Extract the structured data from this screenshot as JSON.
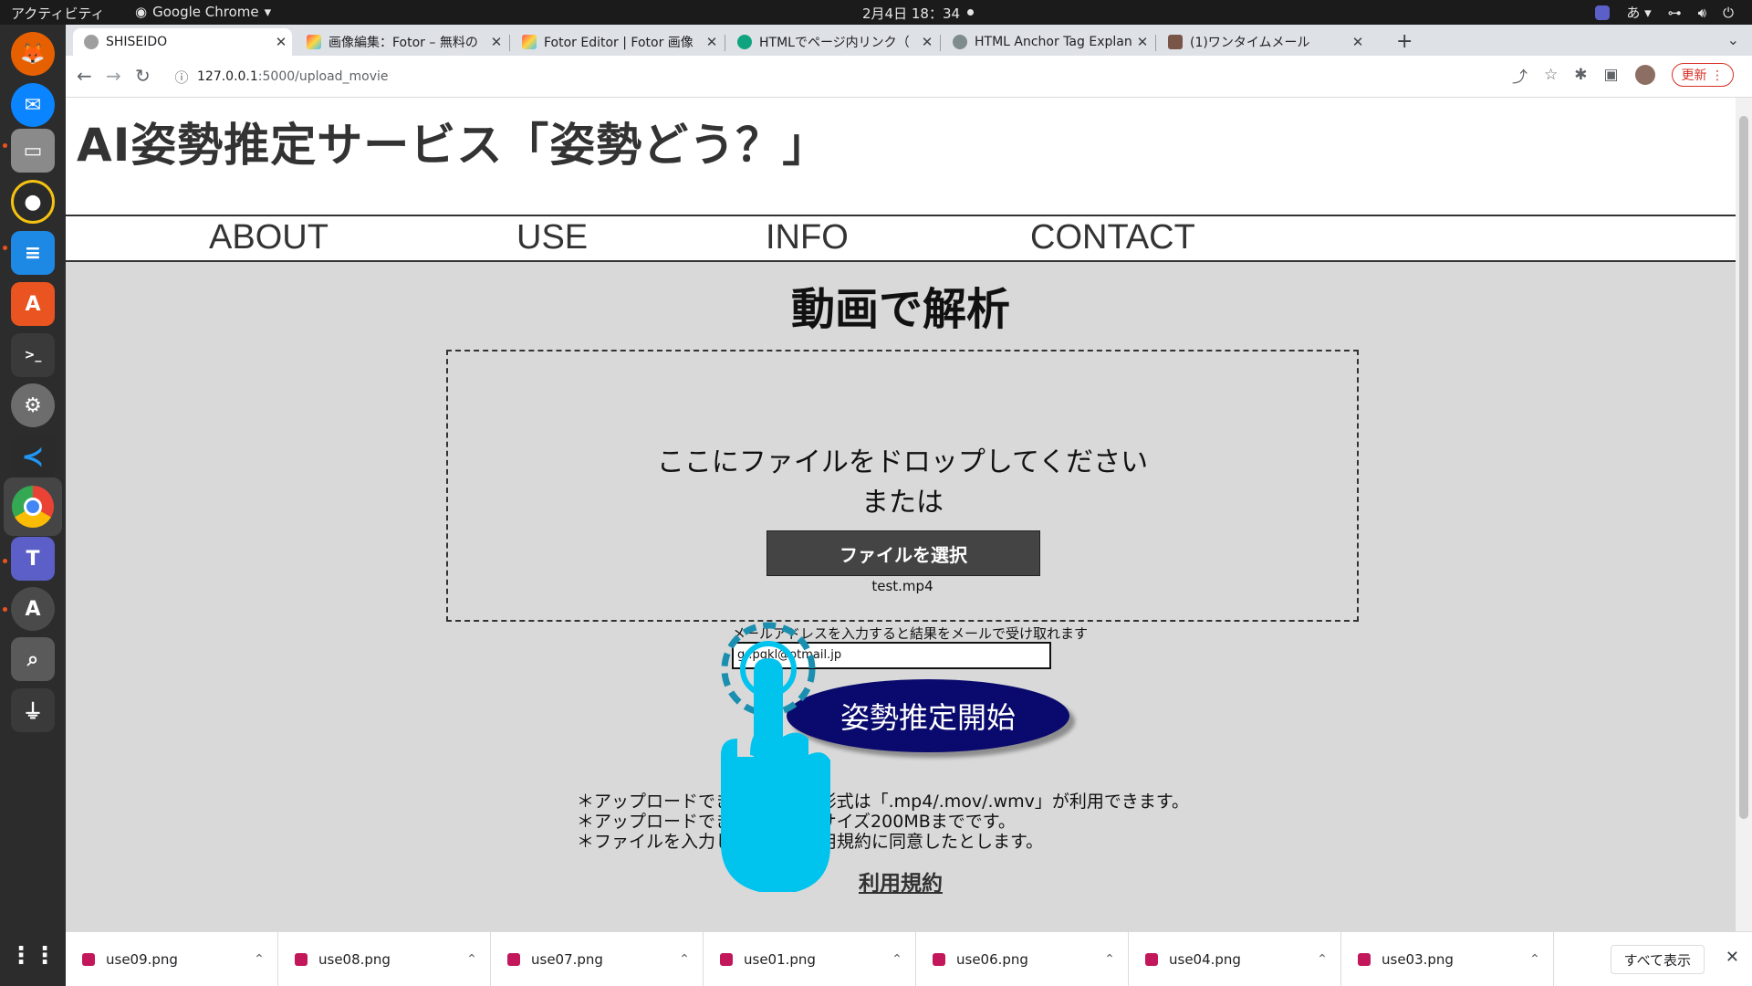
{
  "system": {
    "activities": "アクティビティ",
    "app_name": "Google Chrome",
    "clock": "2月4日  18：34",
    "ime": "あ"
  },
  "browser": {
    "tabs": [
      {
        "label": "SHISEIDO",
        "icon": "globe-icon"
      },
      {
        "label": "画像編集：Fotor – 無料の",
        "icon": "fotor-icon"
      },
      {
        "label": "Fotor Editor | Fotor 画像",
        "icon": "fotor-icon"
      },
      {
        "label": "HTMLでページ内リンク（",
        "icon": "chatgpt-icon"
      },
      {
        "label": "HTML Anchor Tag Explan",
        "icon": "chatgpt-icon"
      },
      {
        "label": "(1)ワンタイムメール",
        "icon": "mail-icon"
      }
    ],
    "url_host": "127.0.0.1",
    "url_path": ":5000/upload_movie",
    "update_label": "更新"
  },
  "site": {
    "title": "AI姿勢推定サービス「姿勢どう？」",
    "nav": [
      "ABOUT",
      "USE",
      "INFO",
      "CONTACT"
    ],
    "heading": "動画で解析",
    "drop_line1": "ここにファイルをドロップしてください",
    "drop_line2": "または",
    "file_button": "ファイルを選択",
    "file_name": "test.mp4",
    "mail_note": "メールアドレスを入力すると結果をメールで受け取れます",
    "mail_value": "gr.pgkl@otmail.jp",
    "start_button": "姿勢推定開始",
    "notes": [
      "＊アップロードできるファイル形式は「.mp4/.mov/.wmv」が利用できます。",
      "＊アップロードできるファイルサイズ200MBまでです。",
      "＊ファイルを入力した段階で利用規約に同意したとします。"
    ],
    "terms": "利用規約"
  },
  "downloads": {
    "items": [
      "use09.png",
      "use08.png",
      "use07.png",
      "use01.png",
      "use06.png",
      "use04.png",
      "use03.png"
    ],
    "show_all": "すべて表示"
  },
  "colors": {
    "accent_button": "#0a0a6e",
    "page_bg": "#d9d9d9",
    "cursor": "#00c3ee"
  }
}
